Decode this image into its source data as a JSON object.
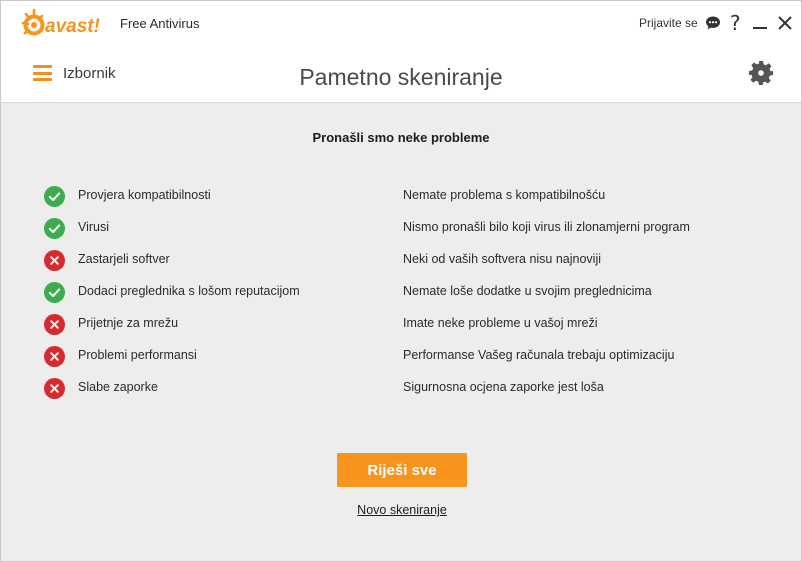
{
  "header": {
    "logo_text": "avast!",
    "product_name": "Free Antivirus",
    "signin_label": "Prijavite se",
    "help_glyph": "?",
    "menu_label": "Izbornik",
    "page_title": "Pametno skeniranje",
    "icons": [
      "avast-logo-icon",
      "chat-icon",
      "help-icon",
      "minimize-icon",
      "close-icon",
      "hamburger-menu-icon",
      "gear-icon"
    ]
  },
  "colors": {
    "accent": "#f7941d",
    "ok": "#3dab4f",
    "problem": "#d52b2f",
    "background": "#ededed",
    "header_bg": "#ffffff"
  },
  "main": {
    "headline": "Pronašli smo neke probleme",
    "results": [
      {
        "status": "ok",
        "name": "Provjera kompatibilnosti",
        "description": "Nemate problema s kompatibilnošću"
      },
      {
        "status": "ok",
        "name": "Virusi",
        "description": "Nismo pronašli bilo koji virus ili zlonamjerni program"
      },
      {
        "status": "problem",
        "name": "Zastarjeli softver",
        "description": "Neki od vaših softvera nisu najnoviji"
      },
      {
        "status": "ok",
        "name": "Dodaci preglednika s lošom reputacijom",
        "description": "Nemate loše dodatke u svojim preglednicima"
      },
      {
        "status": "problem",
        "name": "Prijetnje za mrežu",
        "description": "Imate neke probleme u vašoj mreži"
      },
      {
        "status": "problem",
        "name": "Problemi performansi",
        "description": "Performanse Vašeg računala trebaju optimizaciju"
      },
      {
        "status": "problem",
        "name": "Slabe zaporke",
        "description": "Sigurnosna ocjena zaporke jest loša"
      }
    ],
    "fix_all_label": "Riješi sve",
    "rescan_label": "Novo skeniranje"
  }
}
